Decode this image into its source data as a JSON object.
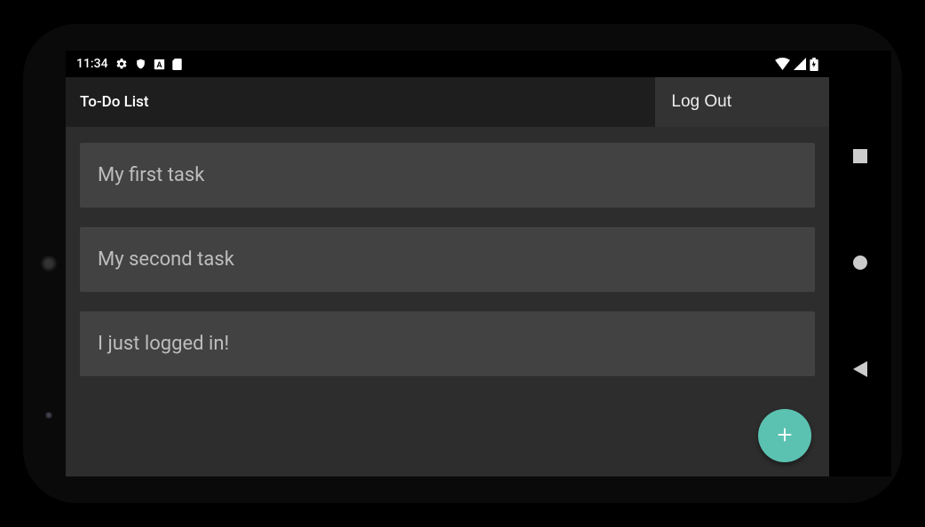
{
  "status_bar": {
    "time": "11:34"
  },
  "app_bar": {
    "title": "To-Do List",
    "logout_label": "Log Out"
  },
  "tasks": [
    {
      "text": "My first task"
    },
    {
      "text": "My second task"
    },
    {
      "text": "I just logged in!"
    }
  ],
  "colors": {
    "accent": "#5bc2b1",
    "background": "#2d2d2d",
    "card": "#424242",
    "appbar": "#1e1e1e"
  },
  "fab": {
    "icon": "plus-icon"
  }
}
